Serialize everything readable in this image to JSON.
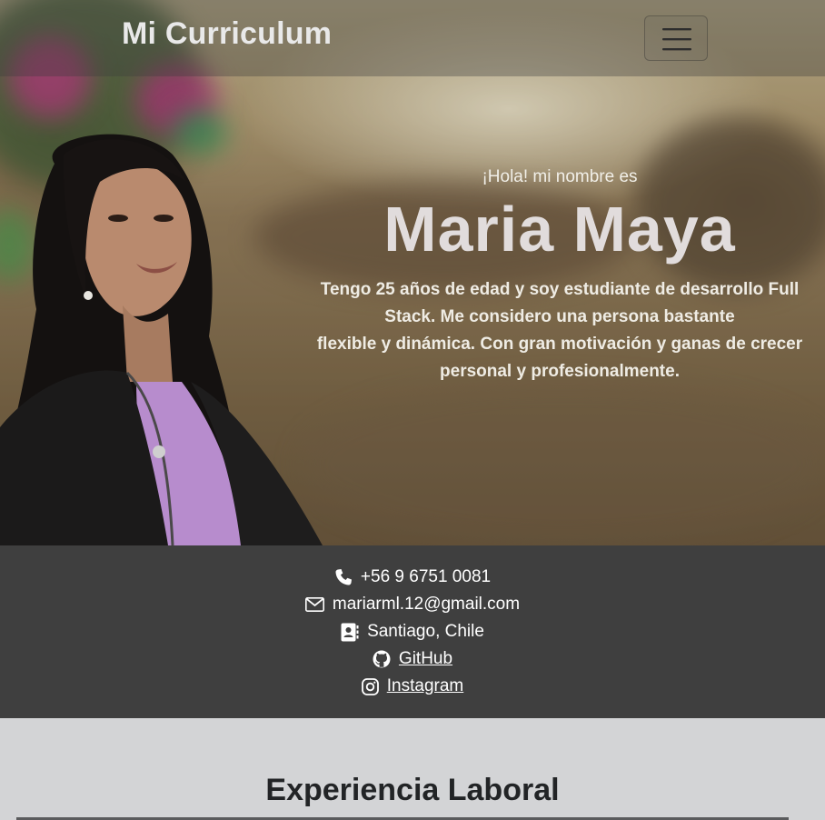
{
  "navbar": {
    "brand": "Mi Curriculum",
    "toggler_icon": "hamburger-icon"
  },
  "hero": {
    "greeting": "¡Hola! mi nombre es",
    "name": "Maria Maya",
    "bio_lines": [
      "Tengo 25 años de edad y soy estudiante de desarrollo Full",
      "Stack. Me considero una persona bastante",
      "flexible y dinámica. Con gran motivación y ganas de crecer",
      "personal y profesionalmente."
    ]
  },
  "contact": {
    "phone": {
      "icon": "phone-icon",
      "text": "+56 9 6751 0081"
    },
    "email": {
      "icon": "envelope-icon",
      "text": "mariarml.12@gmail.com"
    },
    "location": {
      "icon": "address-card-icon",
      "text": "Santiago, Chile"
    },
    "github": {
      "icon": "github-icon",
      "text": "GitHub"
    },
    "instagram": {
      "icon": "instagram-icon",
      "text": "Instagram"
    }
  },
  "experience": {
    "title": "Experiencia Laboral"
  },
  "colors": {
    "contact_bg": "#3f3f3f",
    "experience_bg": "#d3d4d6",
    "name_text": "#e1dcdc"
  }
}
